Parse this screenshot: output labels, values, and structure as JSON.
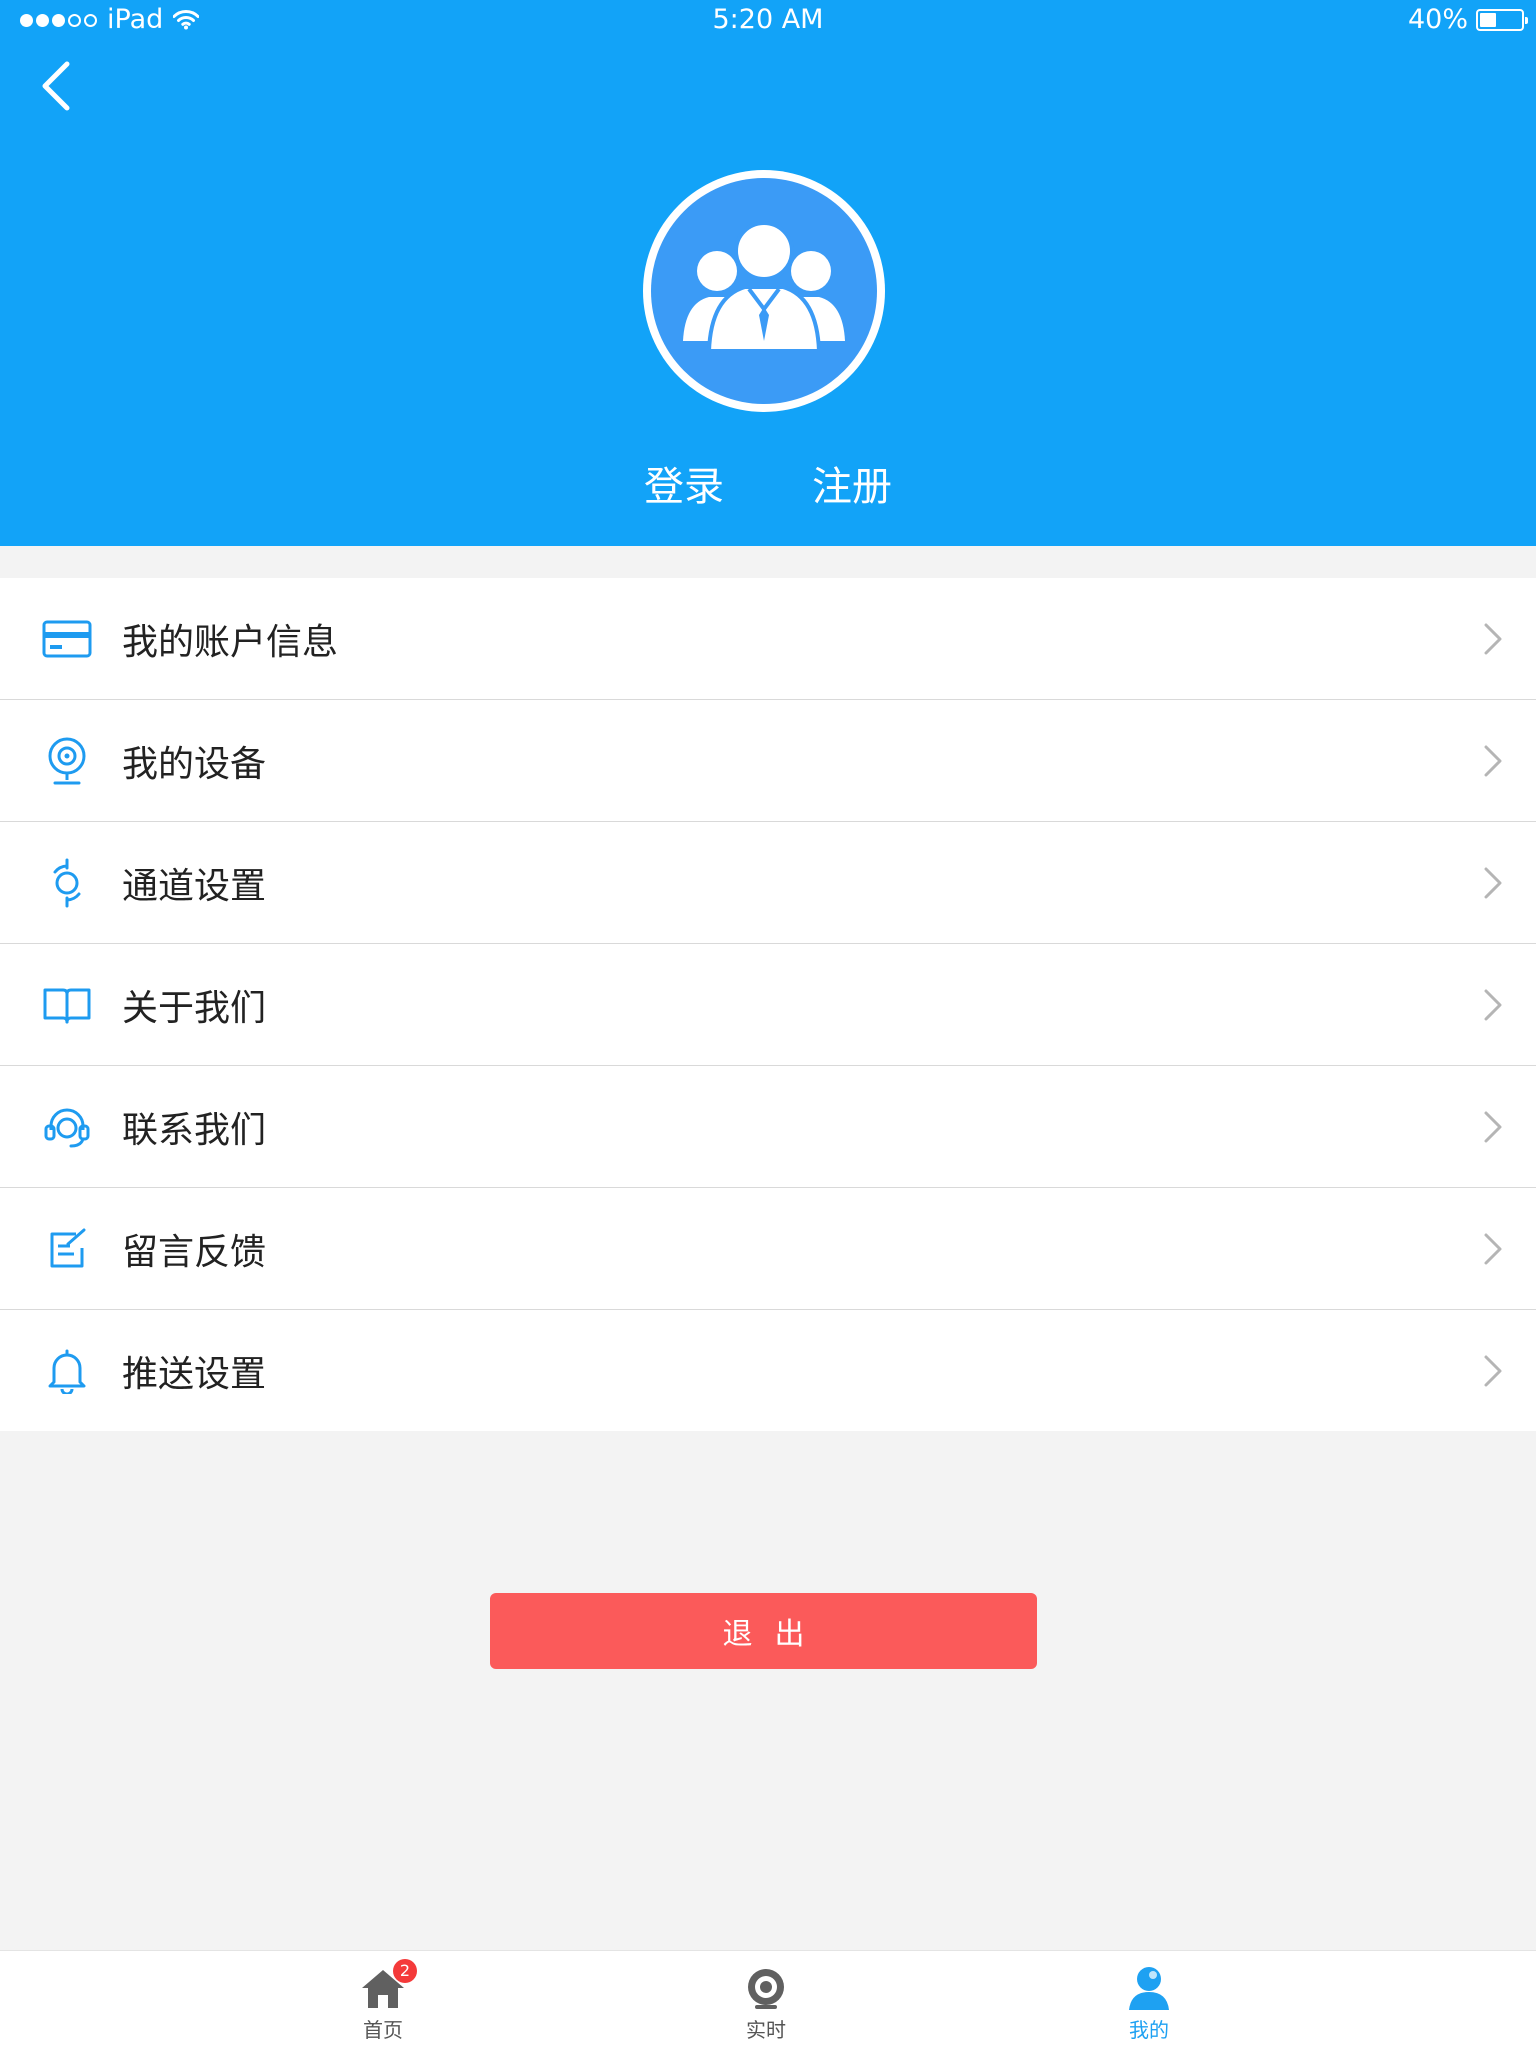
{
  "status_bar": {
    "carrier": "iPad",
    "time": "5:20 AM",
    "battery": "40%",
    "battery_level": 0.4,
    "signal_bars_filled": 3,
    "signal_bars_total": 5
  },
  "header": {
    "background_color": "#12a3f8",
    "login_label": "登录",
    "register_label": "注册",
    "avatar_icon": "users-group-icon",
    "back_icon": "chevron-left-icon"
  },
  "menu": {
    "items": [
      {
        "label": "我的账户信息",
        "icon": "credit-card-icon"
      },
      {
        "label": "我的设备",
        "icon": "webcam-icon"
      },
      {
        "label": "通道设置",
        "icon": "channel-icon"
      },
      {
        "label": "关于我们",
        "icon": "book-icon"
      },
      {
        "label": "联系我们",
        "icon": "headset-icon"
      },
      {
        "label": "留言反馈",
        "icon": "edit-note-icon"
      },
      {
        "label": "推送设置",
        "icon": "bell-icon"
      }
    ]
  },
  "logout": {
    "label": "退出",
    "color": "#fb5a5a"
  },
  "tabbar": {
    "tabs": [
      {
        "label": "首页",
        "icon": "home-icon",
        "badge": "2",
        "active": false
      },
      {
        "label": "实时",
        "icon": "camera-icon",
        "active": false
      },
      {
        "label": "我的",
        "icon": "user-icon",
        "active": true
      }
    ],
    "active_color": "#1ea1f2"
  }
}
